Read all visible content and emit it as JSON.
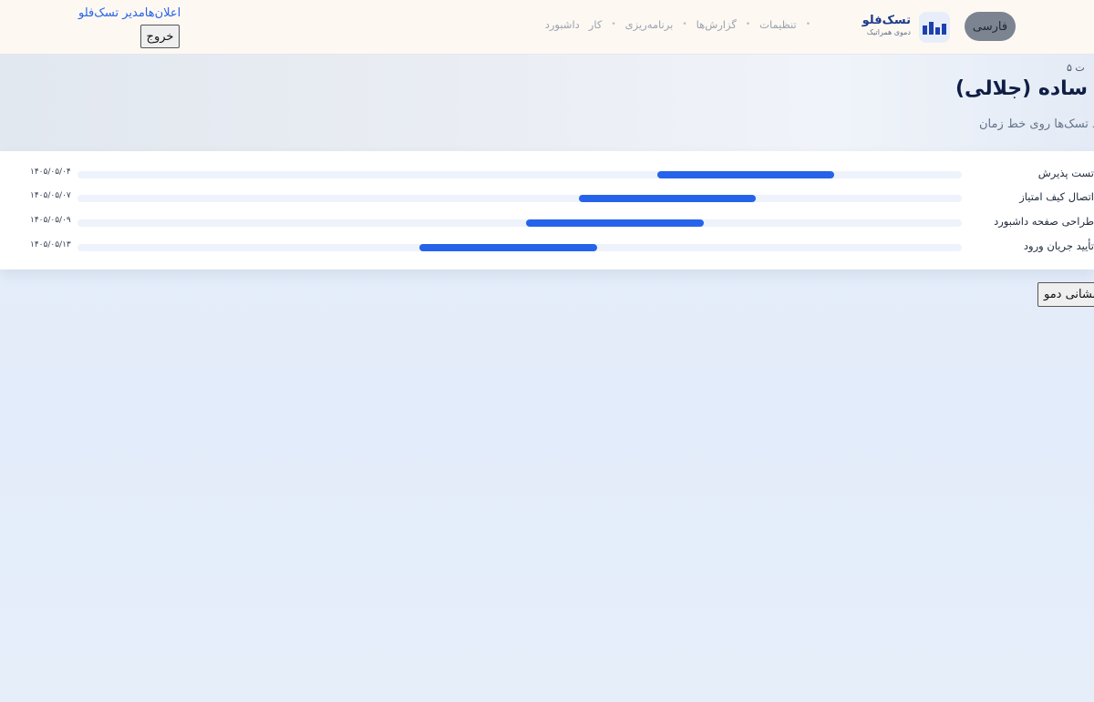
{
  "header": {
    "lang_button": "فارسی",
    "brand_name": "تسک‌فلو",
    "brand_subtitle": "دموی همراتیک",
    "nav": [
      {
        "label": "داشبورد"
      },
      {
        "label": "کار"
      },
      {
        "label": "برنامه‌ریزی"
      },
      {
        "label": "گزارش‌ها"
      },
      {
        "label": "تنظیمات"
      }
    ],
    "notifications_link": "اعلان‌هامدیر تسک‌فلو",
    "logout_button": "خروج"
  },
  "hero": {
    "breadcrumb": "ت ۵",
    "title": "نت ساده (جلالی)",
    "subtitle": "د تسک‌ها روی خط زمان"
  },
  "timeline": [
    {
      "label": "تست پذیرش",
      "date": "۱۴۰۵/۰۵/۰۴",
      "start": 0.656,
      "end": 0.856
    },
    {
      "label": "اتصال کیف امتیاز",
      "date": "۱۴۰۵/۰۵/۰۷",
      "start": 0.567,
      "end": 0.767
    },
    {
      "label": "طراحی صفحه داشبورد",
      "date": "۱۴۰۵/۰۵/۰۹",
      "start": 0.507,
      "end": 0.708
    },
    {
      "label": "تأیید جریان ورود",
      "date": "۱۴۰۵/۰۵/۱۳",
      "start": 0.387,
      "end": 0.588
    }
  ],
  "reset_button": "بازنشانی دمو",
  "colors": {
    "accent": "#2563eb",
    "header_bg": "#fdf8f2",
    "track": "#eef2fb",
    "title": "#0f1e45"
  }
}
